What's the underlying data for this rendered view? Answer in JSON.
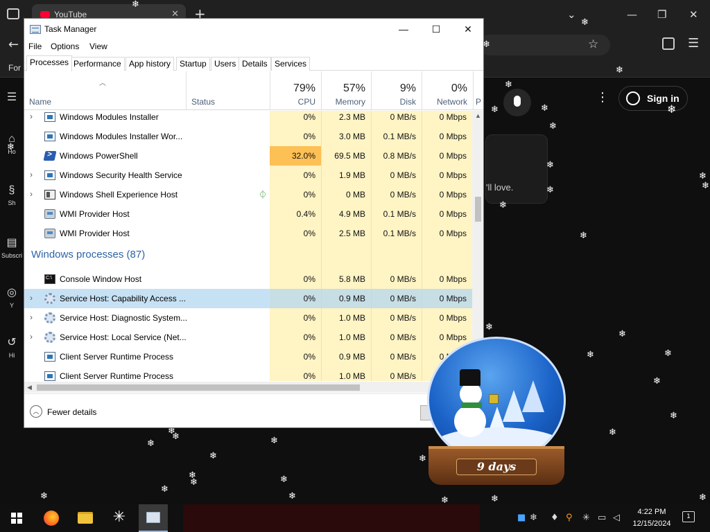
{
  "browser": {
    "tab_title": "YouTube",
    "bookmark_text": "For"
  },
  "youtube": {
    "sidebar": [
      {
        "label": "Ho",
        "icon": "home-icon"
      },
      {
        "label": "Sh",
        "icon": "shorts-icon"
      },
      {
        "label": "Subscri",
        "icon": "subscriptions-icon"
      },
      {
        "label": "Y",
        "icon": "you-icon"
      },
      {
        "label": "Hi",
        "icon": "history-icon"
      }
    ],
    "signin_label": "Sign in",
    "card_text": "'ll love."
  },
  "task_manager": {
    "title": "Task Manager",
    "menu": [
      "File",
      "Options",
      "View"
    ],
    "tabs": [
      "Processes",
      "Performance",
      "App history",
      "Startup",
      "Users",
      "Details",
      "Services"
    ],
    "active_tab": "Processes",
    "columns": {
      "name": "Name",
      "status": "Status",
      "cpu": {
        "label": "CPU",
        "pct": "79%"
      },
      "memory": {
        "label": "Memory",
        "pct": "57%"
      },
      "disk": {
        "label": "Disk",
        "pct": "9%"
      },
      "network": {
        "label": "Network",
        "pct": "0%"
      },
      "power": {
        "label": "P"
      }
    },
    "rows": [
      {
        "name": "Windows Modules Installer",
        "cpu": "0%",
        "memory": "2.3 MB",
        "disk": "0 MB/s",
        "network": "0 Mbps"
      },
      {
        "name": "Windows Modules Installer Wor...",
        "cpu": "0%",
        "memory": "3.0 MB",
        "disk": "0.1 MB/s",
        "network": "0 Mbps"
      },
      {
        "name": "Windows PowerShell",
        "cpu": "32.0%",
        "memory": "69.5 MB",
        "disk": "0.8 MB/s",
        "network": "0 Mbps"
      },
      {
        "name": "Windows Security Health Service",
        "cpu": "0%",
        "memory": "1.9 MB",
        "disk": "0 MB/s",
        "network": "0 Mbps"
      },
      {
        "name": "Windows Shell Experience Host",
        "cpu": "0%",
        "memory": "0 MB",
        "disk": "0 MB/s",
        "network": "0 Mbps"
      },
      {
        "name": "WMI Provider Host",
        "cpu": "0.4%",
        "memory": "4.9 MB",
        "disk": "0.1 MB/s",
        "network": "0 Mbps"
      },
      {
        "name": "WMI Provider Host",
        "cpu": "0%",
        "memory": "2.5 MB",
        "disk": "0.1 MB/s",
        "network": "0 Mbps"
      }
    ],
    "group_header": "Windows processes (87)",
    "group_rows": [
      {
        "name": "Console Window Host",
        "cpu": "0%",
        "memory": "5.8 MB",
        "disk": "0 MB/s",
        "network": "0 Mbps"
      },
      {
        "name": "Service Host: Capability Access ...",
        "cpu": "0%",
        "memory": "0.9 MB",
        "disk": "0 MB/s",
        "network": "0 Mbps"
      },
      {
        "name": "Service Host: Diagnostic System...",
        "cpu": "0%",
        "memory": "1.0 MB",
        "disk": "0 MB/s",
        "network": "0 Mbps"
      },
      {
        "name": "Service Host: Local Service (Net...",
        "cpu": "0%",
        "memory": "1.0 MB",
        "disk": "0 MB/s",
        "network": "0 Mbps"
      },
      {
        "name": "Client Server Runtime Process",
        "cpu": "0%",
        "memory": "0.9 MB",
        "disk": "0 MB/s",
        "network": "0 Mbps"
      },
      {
        "name": "Client Server Runtime Process",
        "cpu": "0%",
        "memory": "1.0 MB",
        "disk": "0 MB/s",
        "network": "0 Mbps"
      }
    ],
    "fewer_details": "Fewer details"
  },
  "snowglobe": {
    "label": "9 days"
  },
  "taskbar": {
    "time": "4:22 PM",
    "date": "12/15/2024",
    "notifications": "1"
  },
  "colors": {
    "cpu_highlight": "#fdc055",
    "column_fill": "#fff4c4",
    "selection": "#b4d7f0",
    "group_header": "#2d64a7"
  }
}
